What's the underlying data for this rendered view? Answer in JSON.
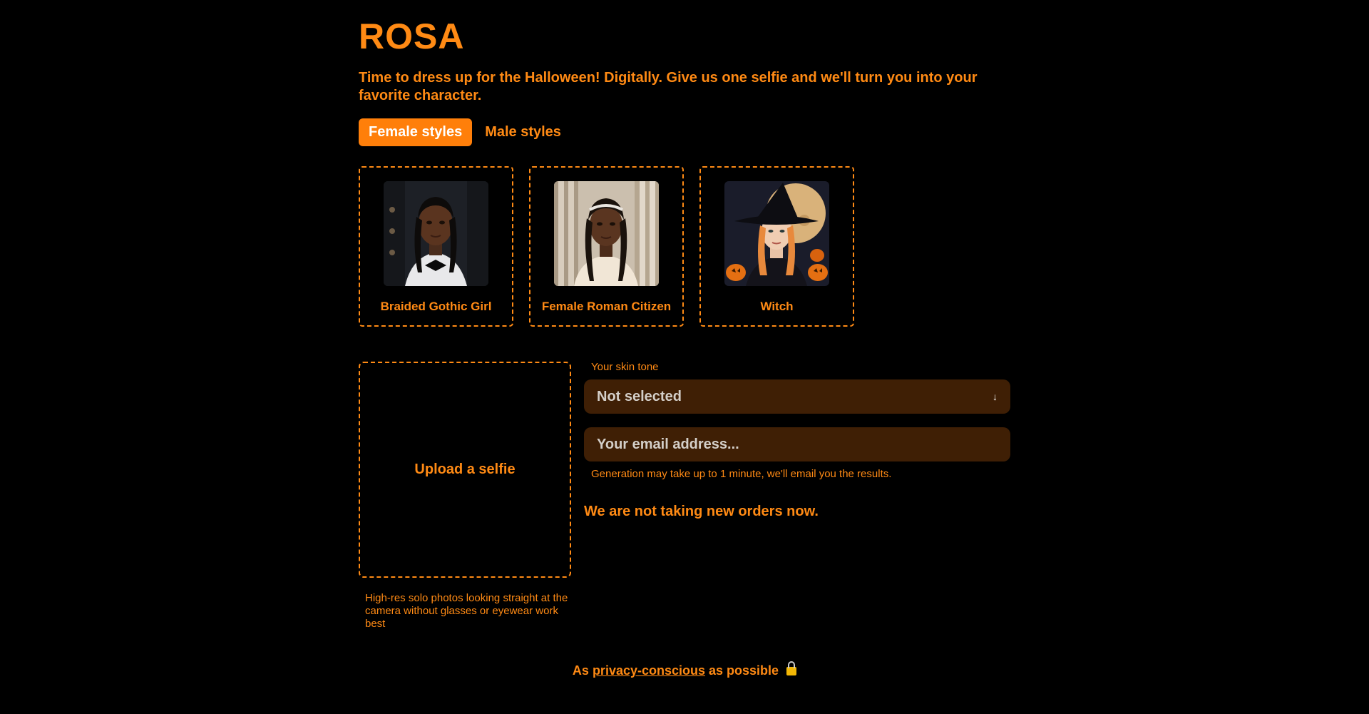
{
  "brand": {
    "title": "ROSA"
  },
  "tagline": "Time to dress up for the Halloween! Digitally. Give us one selfie and we'll turn you into your favorite character.",
  "tabs": [
    {
      "label": "Female styles",
      "active": true
    },
    {
      "label": "Male styles",
      "active": false
    }
  ],
  "styles": [
    {
      "label": "Braided Gothic Girl",
      "image": "braided-gothic-girl-thumbnail"
    },
    {
      "label": "Female Roman Citizen",
      "image": "female-roman-citizen-thumbnail"
    },
    {
      "label": "Witch",
      "image": "witch-thumbnail"
    }
  ],
  "upload": {
    "label": "Upload a selfie",
    "hint": "High-res solo photos looking straight at the camera without glasses or eyewear work best"
  },
  "form": {
    "skin_tone_label": "Your skin tone",
    "skin_tone_value": "Not selected",
    "skin_tone_arrow": "↓",
    "email_placeholder": "Your email address...",
    "generation_note": "Generation may take up to 1 minute, we'll email you the results.",
    "status_message": "We are not taking new orders now."
  },
  "footer": {
    "prefix": "As",
    "link": "privacy-conscious",
    "suffix": "as possible",
    "icon": "lock-icon"
  },
  "colors": {
    "accent": "#ff8a14",
    "active_tab_bg": "#ff7f0a",
    "field_bg": "#3f1f05",
    "background": "#000000"
  }
}
